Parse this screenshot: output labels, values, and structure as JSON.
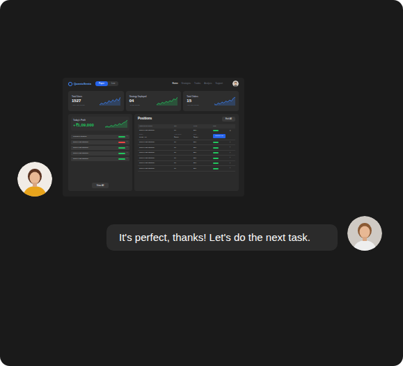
{
  "app": {
    "logo": "QuantoSenta",
    "modes": [
      {
        "label": "Paper",
        "selected": true
      },
      {
        "label": "Live",
        "selected": false
      }
    ],
    "nav": [
      {
        "label": "Home",
        "selected": true
      },
      {
        "label": "Strategies",
        "selected": false
      },
      {
        "label": "Trades",
        "selected": false
      },
      {
        "label": "Analysis",
        "selected": false
      },
      {
        "label": "Support",
        "selected": false
      }
    ]
  },
  "stats": [
    {
      "label": "Total Users",
      "value": "1527",
      "note": "+12% this month",
      "color": "#3b82f6",
      "trend": [
        3,
        5,
        4,
        6,
        5,
        8,
        6,
        9,
        7,
        10,
        8,
        12
      ]
    },
    {
      "label": "Strategy Deployed",
      "value": "04",
      "note": "+2 this month",
      "color": "#22c55e",
      "trend": [
        2,
        4,
        3,
        5,
        4,
        6,
        5,
        7,
        6,
        9,
        8,
        11
      ]
    },
    {
      "label": "Total Orders",
      "value": "15",
      "note": "+5% this month",
      "color": "#3b82f6",
      "trend": [
        4,
        3,
        5,
        4,
        6,
        5,
        7,
        6,
        8,
        7,
        10,
        11
      ]
    }
  ],
  "profit": {
    "label": "Today's Profit",
    "value": "+₹1,09,000",
    "trend": [
      3,
      4,
      3,
      5,
      4,
      6,
      5,
      7,
      6,
      8,
      9,
      11
    ]
  },
  "strategies": [
    {
      "name": "Frangelo Strategy",
      "color": "#22c55e",
      "arrow": "›"
    },
    {
      "name": "Super Fast Strategy",
      "color": "#ef4444",
      "arrow": "›"
    },
    {
      "name": "Super Fast Strategy",
      "color": "#22c55e",
      "arrow": "›"
    },
    {
      "name": "Super Fast Strategy",
      "color": "#22c55e",
      "arrow": "›"
    },
    {
      "name": "Super Fast Strategy",
      "color": "#22c55e",
      "arrow": "›"
    }
  ],
  "view_all": "View All",
  "positions": {
    "title": "Positions",
    "button": "Exit All",
    "columns": [
      "Instrument Name",
      "Qty",
      "Type",
      "P&L"
    ],
    "rows": [
      {
        "kind": "expanded",
        "name": "Super Fast Strategy",
        "qty": "10",
        "type": "Buy",
        "color": "#22c55e",
        "arrow": "▾",
        "details": [
          {
            "label": "Entry",
            "value": "10:24 AM"
          },
          {
            "label": "Avg Price",
            "value": "₹2000"
          },
          {
            "label": "LTP",
            "value": "₹2024"
          }
        ],
        "action": "Square off"
      },
      {
        "kind": "row",
        "name": "Super Fast Strategy",
        "qty": "10",
        "type": "Buy",
        "color": "#22c55e",
        "arrow": "›"
      },
      {
        "kind": "row",
        "name": "Super Fast Strategy",
        "qty": "10",
        "type": "Buy",
        "color": "#22c55e",
        "arrow": "›"
      },
      {
        "kind": "row",
        "name": "Super Fast Strategy",
        "qty": "10",
        "type": "Buy",
        "color": "#22c55e",
        "arrow": "›"
      },
      {
        "kind": "row",
        "name": "Super Fast Strategy",
        "qty": "10",
        "type": "Buy",
        "color": "#22c55e",
        "arrow": "›"
      },
      {
        "kind": "row",
        "name": "Super Fast Strategy",
        "qty": "10",
        "type": "Buy",
        "color": "#22c55e",
        "arrow": "›"
      },
      {
        "kind": "row",
        "name": "Super Fast Strategy",
        "qty": "10",
        "type": "Buy",
        "color": "#22c55e",
        "arrow": "›"
      }
    ]
  },
  "chat": {
    "message": "It's perfect, thanks! Let's do the next task."
  }
}
